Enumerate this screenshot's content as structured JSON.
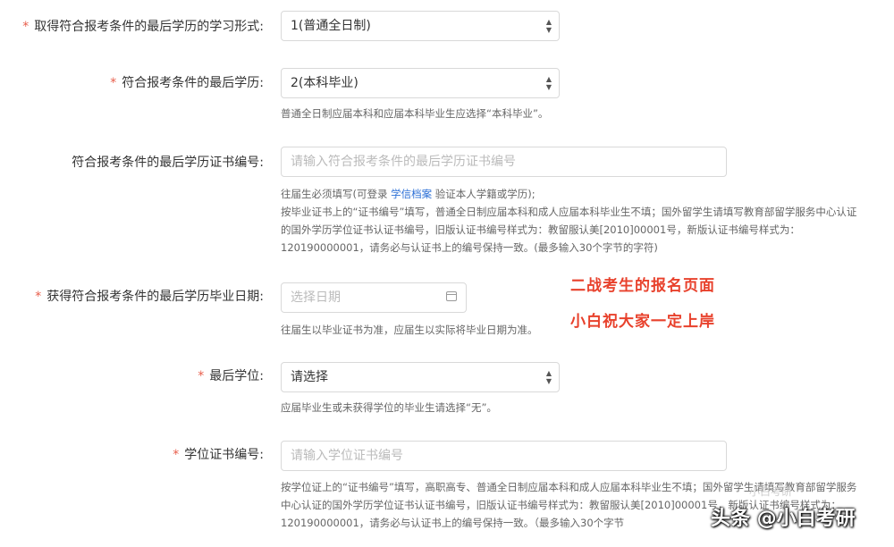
{
  "fields": [
    {
      "required_mark": "*",
      "label": "取得符合报考条件的最后学历的学习形式:",
      "value": "1(普通全日制)"
    },
    {
      "required_mark": "*",
      "label": "符合报考条件的最后学历:",
      "value": "2(本科毕业)",
      "help": "普通全日制应届本科和应届本科毕业生应选择“本科毕业”。"
    },
    {
      "label": "符合报考条件的最后学历证书编号:",
      "placeholder": "请输入符合报考条件的最后学历证书编号",
      "help_line1_before": "往届生必须填写(可登录 ",
      "help_link": "学信档案",
      "help_line1_after": " 验证本人学籍或学历);",
      "help_rest": "按毕业证书上的“证书编号”填写，普通全日制应届本科和成人应届本科毕业生不填；国外留学生请填写教育部留学服务中心认证的国外学历学位证书认证书编号，旧版认证书编号样式为：教留服认美[2010]00001号，新版认证书编号样式为：120190000001，请务必与认证书上的编号保持一致。(最多输入30个字节的字符)"
    },
    {
      "required_mark": "*",
      "label": "获得符合报考条件的最后学历毕业日期:",
      "placeholder": "选择日期",
      "help": "往届生以毕业证书为准，应届生以实际将毕业日期为准。"
    },
    {
      "required_mark": "*",
      "label": "最后学位:",
      "value": "请选择",
      "help": "应届毕业生或未获得学位的毕业生请选择“无”。"
    },
    {
      "required_mark": "*",
      "label": "学位证书编号:",
      "placeholder": "请输入学位证书编号",
      "help": "按学位证上的“证书编号”填写，高职高专、普通全日制应届本科和成人应届本科毕业生不填；国外留学生请填写教育部留学服务中心认证的国外学历学位证书认证书编号，旧版认证书编号样式为：教留服认美[2010]00001号，新版认证书编号样式为：120190000001，请务必与认证书上的编号保持一致。（最多输入30个字节"
    }
  ],
  "overlay": {
    "line1": "二战考生的报名页面",
    "line2": "小白祝大家一定上岸"
  },
  "watermark": {
    "text": "头条 @小白考研",
    "faint": "小白考研"
  },
  "icons": {
    "select_arrows": "updown-arrows-icon",
    "calendar": "calendar-icon"
  }
}
